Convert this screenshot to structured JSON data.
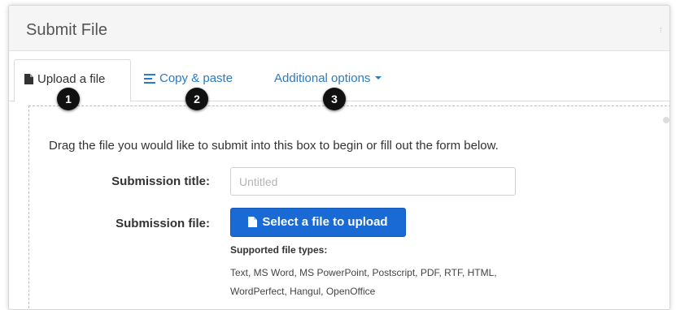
{
  "panel": {
    "title": "Submit File"
  },
  "tabs": [
    {
      "label": "Upload a file",
      "icon": "file-icon",
      "active": true
    },
    {
      "label": "Copy & paste",
      "icon": "align-left-icon",
      "active": false
    },
    {
      "label": "Additional options",
      "icon": "caret-down-icon",
      "active": false
    }
  ],
  "badges": [
    "1",
    "2",
    "3"
  ],
  "form": {
    "instructions": "Drag the file you would like to submit into this box to begin or fill out the form below.",
    "title_label": "Submission title:",
    "title_placeholder": "Untitled",
    "file_label": "Submission file:",
    "upload_button": "Select a file to upload",
    "supported_heading": "Supported file types:",
    "supported_types": "Text, MS Word, MS PowerPoint, Postscript, PDF, RTF, HTML, WordPerfect, Hangul, OpenOffice"
  },
  "colors": {
    "link": "#2a7bc0",
    "primary_button": "#1a6ad6",
    "badge": "#111111"
  }
}
